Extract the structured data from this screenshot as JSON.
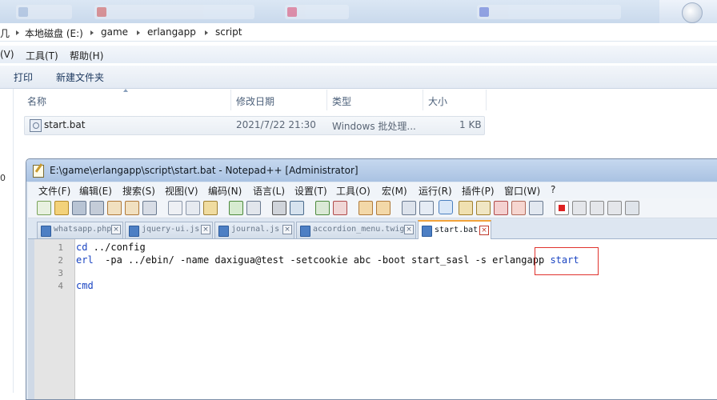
{
  "explorer": {
    "breadcrumb": {
      "root_fragment": "几",
      "drive": "本地磁盘 (E:)",
      "folders": [
        "game",
        "erlangapp",
        "script"
      ]
    },
    "menu": [
      "(V)",
      "工具(T)",
      "帮助(H)"
    ],
    "commands": [
      "打印",
      "新建文件夹"
    ],
    "side_fragment": "0",
    "columns": {
      "name": "名称",
      "modified": "修改日期",
      "type": "类型",
      "size": "大小"
    },
    "files": [
      {
        "name": "start.bat",
        "modified": "2021/7/22 21:30",
        "type": "Windows 批处理...",
        "size": "1 KB"
      }
    ]
  },
  "notepad": {
    "title": "E:\\game\\erlangapp\\script\\start.bat - Notepad++ [Administrator]",
    "menu": [
      "文件(F)",
      "编辑(E)",
      "搜索(S)",
      "视图(V)",
      "编码(N)",
      "语言(L)",
      "设置(T)",
      "工具(O)",
      "宏(M)",
      "运行(R)",
      "插件(P)",
      "窗口(W)",
      "?"
    ],
    "tabs": [
      {
        "label": "whatsapp.php",
        "active": false
      },
      {
        "label": "jquery-ui.js",
        "active": false
      },
      {
        "label": "journal.js",
        "active": false
      },
      {
        "label": "accordion_menu.twig",
        "active": false
      },
      {
        "label": "start.bat",
        "active": true
      }
    ],
    "lines": [
      {
        "num": "1",
        "kw": "cd",
        "text": " ../config"
      },
      {
        "num": "2",
        "kw": "erl",
        "text": "  -pa ../ebin/ -name daxigua@test -setcookie abc -boot start_sasl -s erlangapp",
        "kw2": "start"
      },
      {
        "num": "3",
        "kw": "",
        "text": ""
      },
      {
        "num": "4",
        "kw": "cmd",
        "text": ""
      }
    ]
  },
  "colors": {
    "keyword": "#1a44c2",
    "highlight_box": "#e0322d",
    "active_tab_accent": "#f2a33a"
  }
}
